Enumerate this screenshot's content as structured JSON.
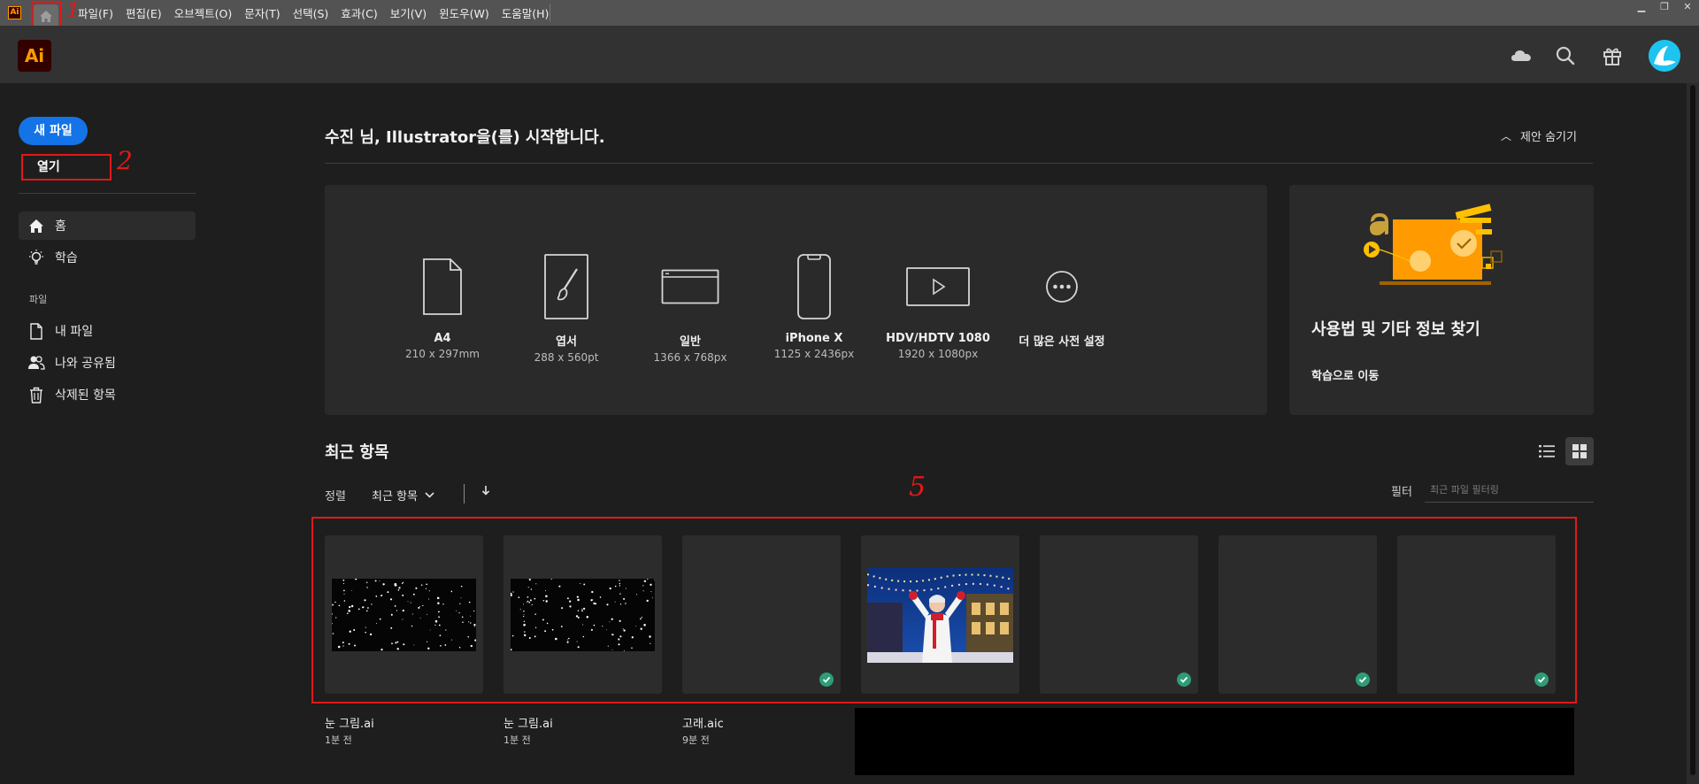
{
  "menubar": {
    "app_icon": "Ai",
    "menus": [
      "파일(F)",
      "편집(E)",
      "오브젝트(O)",
      "문자(T)",
      "선택(S)",
      "효과(C)",
      "보기(V)",
      "윈도우(W)",
      "도움말(H)"
    ],
    "window_controls": [
      "minimize-icon",
      "restore-icon",
      "close-icon"
    ]
  },
  "annotations": {
    "n1": "1",
    "n2": "2",
    "n5": "5",
    "color": "#e31818"
  },
  "header": {
    "logo": "Ai",
    "icons": [
      "cloud-icon",
      "search-icon",
      "gift-icon",
      "avatar"
    ]
  },
  "sidebar": {
    "new_file": "새 파일",
    "open": "열기",
    "nav": [
      {
        "label": "홈",
        "icon": "home-icon",
        "active": true
      },
      {
        "label": "학습",
        "icon": "lightbulb-icon",
        "active": false
      }
    ],
    "group_label": "파일",
    "files_nav": [
      {
        "label": "내 파일",
        "icon": "document-icon"
      },
      {
        "label": "나와 공유됨",
        "icon": "shared-users-icon"
      },
      {
        "label": "삭제된 항목",
        "icon": "trash-icon"
      }
    ]
  },
  "main": {
    "welcome": "수진 님, Illustrator을(를) 시작합니다.",
    "hide_suggestions": "제안 숨기기",
    "presets": [
      {
        "name": "A4",
        "size": "210 x 297mm",
        "icon": "document-page-icon"
      },
      {
        "name": "엽서",
        "size": "288 x 560pt",
        "icon": "postcard-brush-icon"
      },
      {
        "name": "일반",
        "size": "1366 x 768px",
        "icon": "browser-window-icon"
      },
      {
        "name": "iPhone X",
        "size": "1125 x 2436px",
        "icon": "phone-icon"
      },
      {
        "name": "HDV/HDTV 1080",
        "size": "1920 x 1080px",
        "icon": "video-play-icon"
      },
      {
        "name": "더 많은 사전 설정",
        "size": "",
        "icon": "more-dots-icon"
      }
    ],
    "learn_card": {
      "title": "사용법 및 기타 정보 찾기",
      "link": "학습으로 이동"
    },
    "recent": {
      "title": "최근 항목",
      "sort_label": "정렬",
      "sort_value": "최근 항목",
      "filter_label": "필터",
      "filter_placeholder": "최근 파일 필터링",
      "files": [
        {
          "name": "눈 그림.ai",
          "date": "1분 전",
          "kind": "snow",
          "synced": false
        },
        {
          "name": "눈 그림.ai",
          "date": "1분 전",
          "kind": "snow",
          "synced": false
        },
        {
          "name": "고래.aic",
          "date": "9분 전",
          "kind": "blank",
          "synced": true
        },
        {
          "name": "",
          "date": "",
          "kind": "photo",
          "synced": false
        },
        {
          "name": "",
          "date": "",
          "kind": "blank",
          "synced": true
        },
        {
          "name": "",
          "date": "",
          "kind": "blank",
          "synced": true
        },
        {
          "name": "",
          "date": "",
          "kind": "blank",
          "synced": true
        }
      ]
    }
  },
  "colors": {
    "accent_blue": "#1473e6",
    "sync_green": "#2d9d78",
    "ai_orange": "#ff9a00",
    "ai_dark": "#330000"
  }
}
